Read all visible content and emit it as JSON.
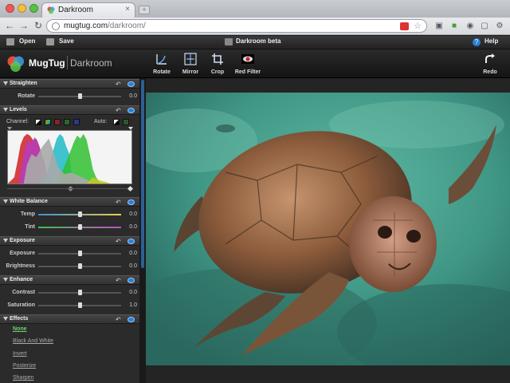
{
  "browser": {
    "tab_title": "Darkroom",
    "tab_close": "×",
    "newtab": "+",
    "url_host": "mugtug.com",
    "url_path": "/darkroom/"
  },
  "appbar": {
    "open": "Open",
    "save": "Save",
    "title": "Darkroom beta",
    "help": "Help"
  },
  "header": {
    "brand": "MugTug",
    "sub": "Darkroom",
    "tools": {
      "rotate": "Rotate",
      "mirror": "Mirror",
      "crop": "Crop",
      "red_filter": "Red Filter",
      "redo": "Redo"
    }
  },
  "sections": {
    "straighten": {
      "title": "Straighten",
      "rows": [
        {
          "label": "Rotate",
          "value": "0.0",
          "level": 0.5
        }
      ]
    },
    "levels": {
      "title": "Levels",
      "channel_label": "Channel:",
      "auto_label": "Auto:"
    },
    "white_balance": {
      "title": "White Balance",
      "rows": [
        {
          "label": "Temp",
          "value": "0.0",
          "level": 0.5
        },
        {
          "label": "Tint",
          "value": "0.0",
          "level": 0.5
        }
      ]
    },
    "exposure": {
      "title": "Exposure",
      "rows": [
        {
          "label": "Exposure",
          "value": "0.0",
          "level": 0.5
        },
        {
          "label": "Brightness",
          "value": "0.0",
          "level": 0.5
        }
      ]
    },
    "enhance": {
      "title": "Enhance",
      "rows": [
        {
          "label": "Contrast",
          "value": "0.0",
          "level": 0.5
        },
        {
          "label": "Saturation",
          "value": "1.0",
          "level": 0.5
        }
      ]
    },
    "effects": {
      "title": "Effects",
      "items": [
        "None",
        "Black And White",
        "Invert",
        "Posterize",
        "Sharpen"
      ],
      "active": "None"
    }
  },
  "colors": {
    "accent": "#2b7fd6",
    "active_effect": "#6fd070",
    "panel": "#2b2b2b"
  }
}
